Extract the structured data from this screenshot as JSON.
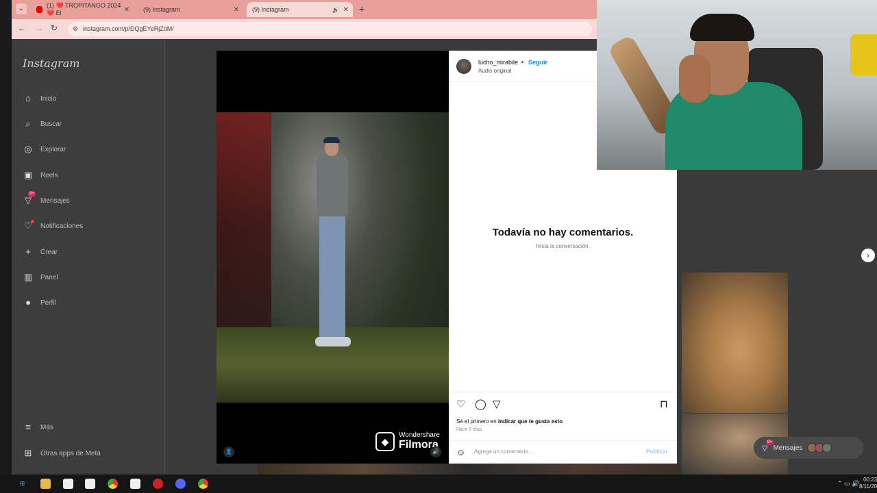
{
  "browser": {
    "tabs": [
      {
        "label": "(1) ❤️ TROPITANGO 2024 ❤️ El",
        "favicon": "youtube-icon"
      },
      {
        "label": "(9) Instagram",
        "favicon": "instagram-icon"
      },
      {
        "label": "(9) Instagram",
        "favicon": "instagram-icon"
      }
    ],
    "url": "instagram.com/p/DQgEYeRjZdM/"
  },
  "instagram": {
    "logo": "Instagram",
    "nav": [
      {
        "label": "Inicio",
        "icon": "home-icon"
      },
      {
        "label": "Buscar",
        "icon": "search-icon"
      },
      {
        "label": "Explorar",
        "icon": "compass-icon"
      },
      {
        "label": "Reels",
        "icon": "reels-icon"
      },
      {
        "label": "Mensajes",
        "icon": "messenger-icon",
        "badge": "9+"
      },
      {
        "label": "Notificaciones",
        "icon": "heart-icon"
      },
      {
        "label": "Crear",
        "icon": "plus-icon"
      },
      {
        "label": "Panel",
        "icon": "chart-icon"
      },
      {
        "label": "Perfil",
        "icon": "avatar-icon"
      }
    ],
    "more": "Más",
    "meta_apps": "Otras apps de Meta",
    "post": {
      "username": "lucho_mirabile",
      "separator": "•",
      "follow": "Seguir",
      "audio": "Audio original",
      "empty_title": "Todavía no hay comentarios.",
      "empty_sub": "Inicia la conversación.",
      "likes_prefix": "Sé el primero en ",
      "likes_link": "indicar que te gusta esto",
      "date": "Hace 6 días",
      "comment_placeholder": "Agrega un comentario...",
      "publish": "Publicar",
      "watermark_line1": "Wondershare",
      "watermark_line2": "Filmora"
    },
    "messages_pill": {
      "label": "Mensajes",
      "badge": "9+"
    }
  },
  "taskbar": {
    "time": "00:23",
    "date": "8/11/20"
  },
  "colors": {
    "accent": "#0095f6",
    "badge": "#e0245e",
    "tabbar": "#e9a09a"
  }
}
